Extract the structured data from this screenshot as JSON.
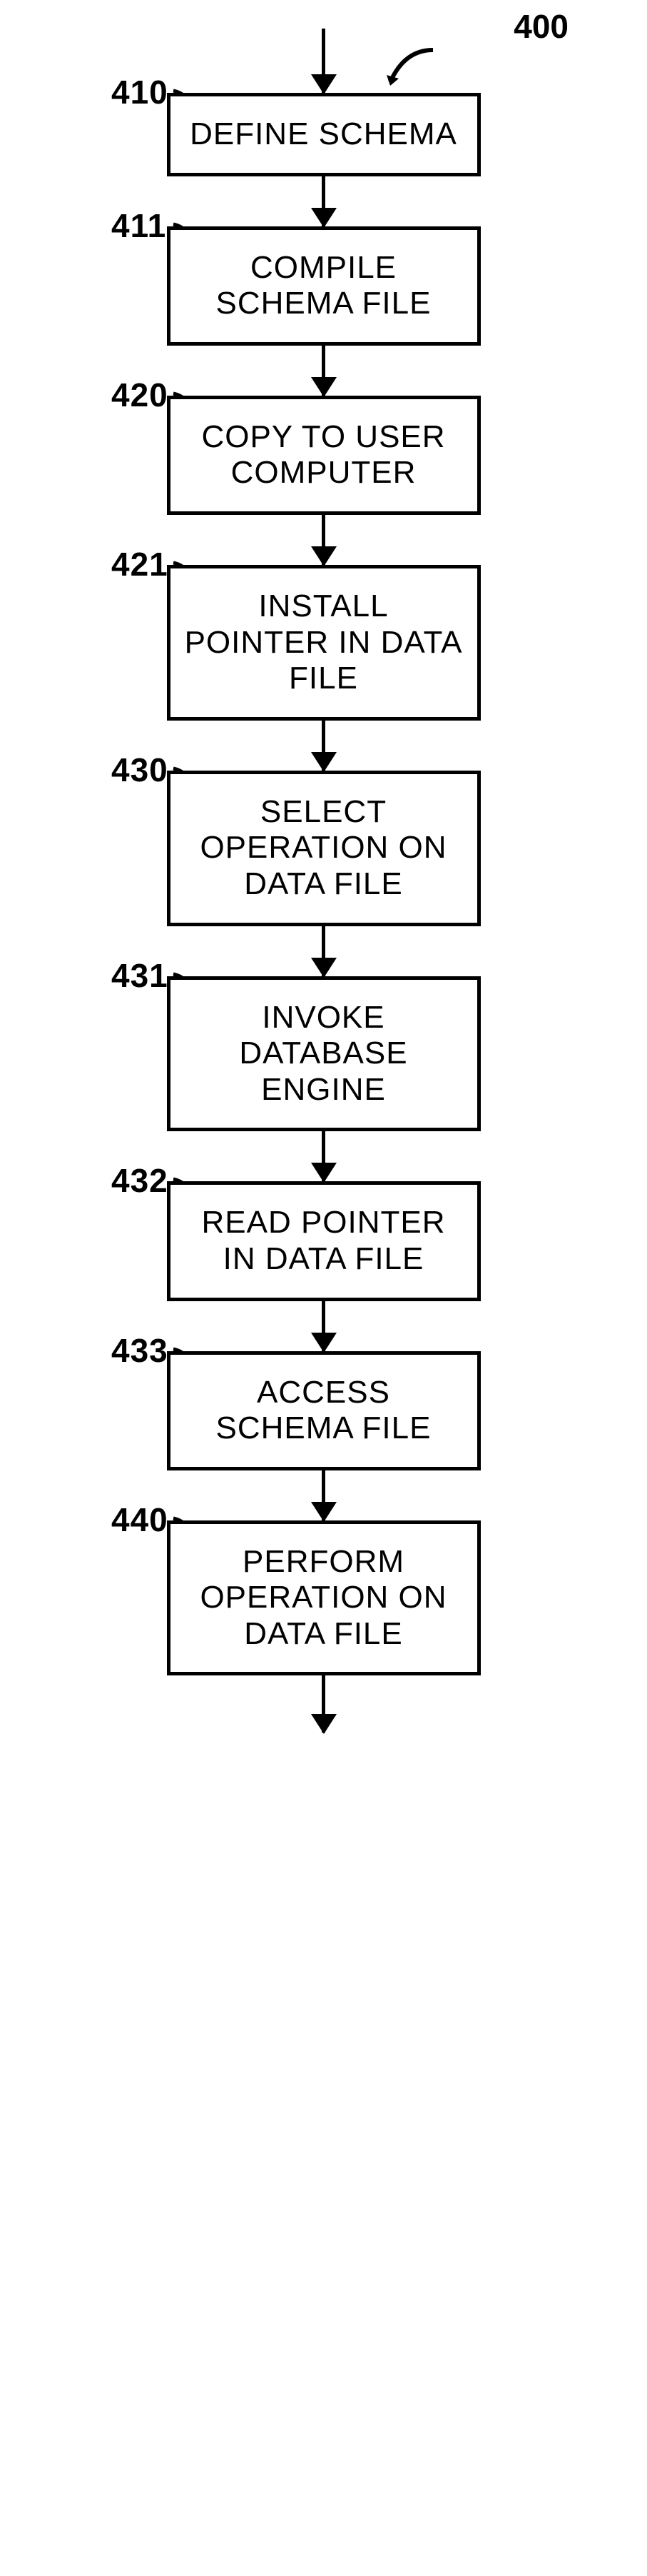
{
  "diagram": {
    "id_label": "400",
    "steps": [
      {
        "num": "410",
        "text": "DEFINE SCHEMA"
      },
      {
        "num": "411",
        "text": "COMPILE SCHEMA FILE"
      },
      {
        "num": "420",
        "text": "COPY TO USER COMPUTER"
      },
      {
        "num": "421",
        "text": "INSTALL POINTER IN DATA FILE"
      },
      {
        "num": "430",
        "text": "SELECT OPERATION ON DATA FILE"
      },
      {
        "num": "431",
        "text": "INVOKE DATABASE ENGINE"
      },
      {
        "num": "432",
        "text": "READ POINTER IN DATA FILE"
      },
      {
        "num": "433",
        "text": "ACCESS SCHEMA FILE"
      },
      {
        "num": "440",
        "text": "PERFORM OPERATION ON DATA FILE"
      }
    ]
  }
}
